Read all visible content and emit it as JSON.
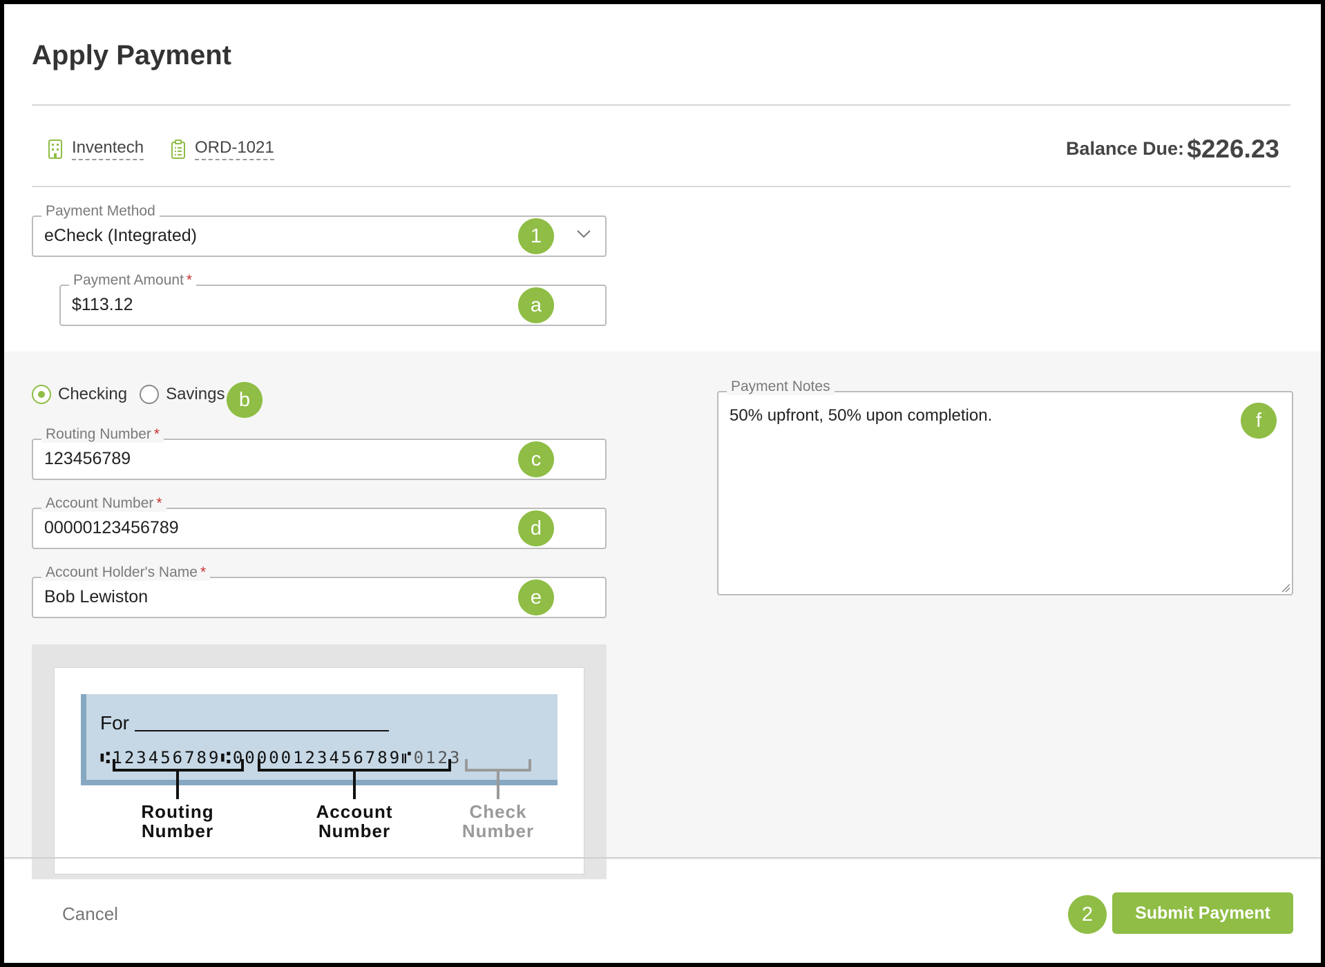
{
  "header": {
    "title": "Apply Payment"
  },
  "meta": {
    "company": {
      "label": "Inventech",
      "icon": "building-icon"
    },
    "order": {
      "label": "ORD-1021",
      "icon": "clipboard-icon"
    },
    "balance_label": "Balance Due:",
    "balance_value": "$226.23"
  },
  "form": {
    "payment_method": {
      "label": "Payment Method",
      "value": "eCheck (Integrated)",
      "badge": "1"
    },
    "payment_amount": {
      "label": "Payment Amount",
      "required": "*",
      "value": "$113.12",
      "badge": "a"
    },
    "account_type": {
      "options": [
        {
          "label": "Checking",
          "selected": true
        },
        {
          "label": "Savings",
          "selected": false
        }
      ],
      "badge": "b"
    },
    "routing_number": {
      "label": "Routing Number",
      "required": "*",
      "value": "123456789",
      "badge": "c"
    },
    "account_number": {
      "label": "Account Number",
      "required": "*",
      "value": "00000123456789",
      "badge": "d"
    },
    "account_holder": {
      "label": "Account Holder's Name",
      "required": "*",
      "value": "Bob Lewiston",
      "badge": "e"
    },
    "payment_notes": {
      "label": "Payment Notes",
      "value": "50% upfront, 50% upon completion.",
      "badge": "f"
    }
  },
  "check_diagram": {
    "for_label": "For",
    "routing_digits": "123456789",
    "account_digits": "00000123456789",
    "check_digits": "0123",
    "routing_label_1": "Routing",
    "routing_label_2": "Number",
    "account_label_1": "Account",
    "account_label_2": "Number",
    "check_label_1": "Check",
    "check_label_2": "Number"
  },
  "footer": {
    "cancel_label": "Cancel",
    "submit_label": "Submit Payment",
    "submit_badge": "2"
  },
  "colors": {
    "accent": "#8fbd45",
    "required": "#c83232",
    "panel_bg": "#f6f6f6"
  }
}
